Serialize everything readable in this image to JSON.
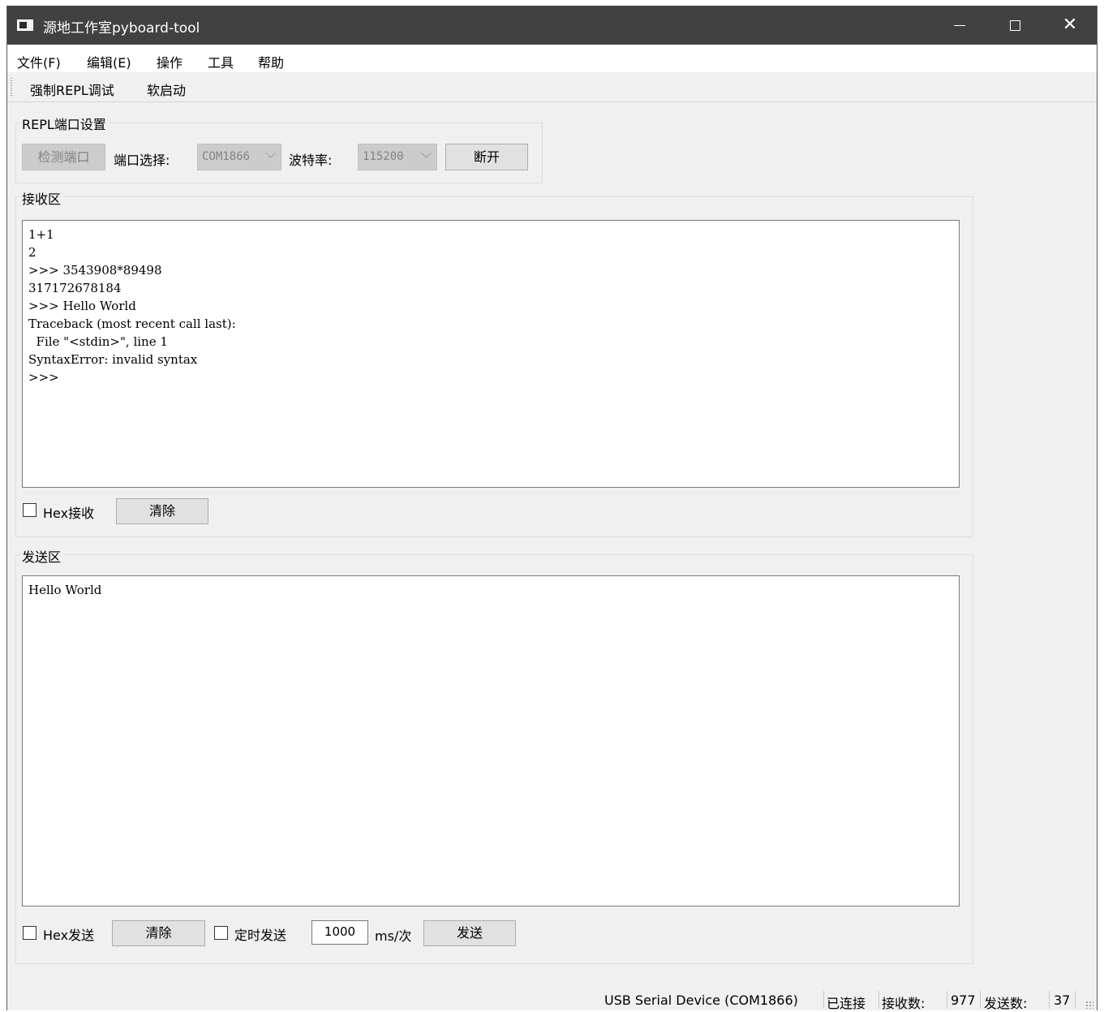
{
  "window": {
    "title": "源地工作室pyboard-tool"
  },
  "menubar": {
    "items": [
      "文件(F)",
      "编辑(E)",
      "操作",
      "工具",
      "帮助"
    ]
  },
  "toolbar": {
    "force_repl": "强制REPL调试",
    "soft_reset": "软启动"
  },
  "port_settings": {
    "title": "REPL端口设置",
    "detect_button": "检测端口",
    "port_label": "端口选择:",
    "port_value": "COM1866",
    "baud_label": "波特率:",
    "baud_value": "115200",
    "disconnect_button": "断开"
  },
  "receive": {
    "title": "接收区",
    "content": "1+1\n2\n>>> 3543908*89498\n317172678184\n>>> Hello World\nTraceback (most recent call last):\n  File \"<stdin>\", line 1\nSyntaxError: invalid syntax\n>>>",
    "hex_label": "Hex接收",
    "hex_checked": false,
    "clear_button": "清除"
  },
  "send": {
    "title": "发送区",
    "content": "Hello World",
    "hex_label": "Hex发送",
    "hex_checked": false,
    "clear_button": "清除",
    "timer_label": "定时发送",
    "timer_checked": false,
    "interval_value": "1000",
    "interval_unit": "ms/次",
    "send_button": "发送"
  },
  "statusbar": {
    "device": "USB Serial Device (COM1866)",
    "connection": "已连接",
    "rx_label": "接收数:",
    "rx_count": "977",
    "tx_label": "发送数:",
    "tx_count": "37"
  }
}
